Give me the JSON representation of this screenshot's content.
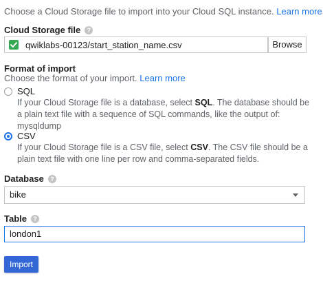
{
  "intro": {
    "text": "Choose a Cloud Storage file to import into your Cloud SQL instance.",
    "link": "Learn more"
  },
  "storage": {
    "label": "Cloud Storage file",
    "file": "qwiklabs-00123/start_station_name.csv",
    "browse": "Browse",
    "file_icon": "check-icon",
    "file_icon_color": "#34a853"
  },
  "format": {
    "heading": "Format of import",
    "subtitle": "Choose the format of your import.",
    "subtitle_link": "Learn more",
    "options": [
      {
        "label": "SQL",
        "desc_prefix": "If your Cloud Storage file is a database, select ",
        "desc_bold": "SQL",
        "desc_rest": ". The database should be a plain text file with a sequence of SQL commands, like the output of: mysqldump",
        "selected": false
      },
      {
        "label": "CSV",
        "desc_prefix": "If your Cloud Storage file is a CSV file, select ",
        "desc_bold": "CSV",
        "desc_rest": ". The CSV file should be a plain text file with one line per row and comma-separated fields.",
        "selected": true
      }
    ]
  },
  "database": {
    "label": "Database",
    "value": "bike"
  },
  "table": {
    "label": "Table",
    "value": "london1"
  },
  "actions": {
    "import": "Import"
  },
  "colors": {
    "accent": "#1a73e8",
    "button": "#3367d6"
  }
}
